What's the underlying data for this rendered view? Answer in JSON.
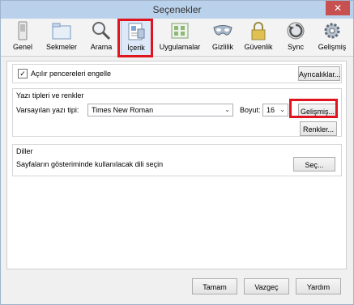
{
  "window": {
    "title": "Seçenekler",
    "close_glyph": "✕"
  },
  "toolbar": [
    {
      "label": "Genel",
      "icon": "switch-icon"
    },
    {
      "label": "Sekmeler",
      "icon": "tabs-icon"
    },
    {
      "label": "Arama",
      "icon": "magnifier-icon"
    },
    {
      "label": "İçerik",
      "icon": "document-icon",
      "active": true
    },
    {
      "label": "Uygulamalar",
      "icon": "apps-icon"
    },
    {
      "label": "Gizlilik",
      "icon": "mask-icon"
    },
    {
      "label": "Güvenlik",
      "icon": "lock-icon"
    },
    {
      "label": "Sync",
      "icon": "sync-icon"
    },
    {
      "label": "Gelişmiş",
      "icon": "gear-icon"
    }
  ],
  "popups": {
    "checkbox_label": "Açılır pencereleri engelle",
    "checked": true,
    "exceptions_button": "Ayrıcalıklar..."
  },
  "fonts": {
    "section_title": "Yazı tipleri ve renkler",
    "default_font_label": "Varsayılan yazı tipi:",
    "default_font_value": "Times New Roman",
    "size_label": "Boyut:",
    "size_value": "16",
    "advanced_button": "Gelişmiş...",
    "colors_button": "Renkler..."
  },
  "languages": {
    "section_title": "Diller",
    "description": "Sayfaların gösteriminde kullanılacak dili seçin",
    "choose_button": "Seç..."
  },
  "footer": {
    "ok": "Tamam",
    "cancel": "Vazgeç",
    "help": "Yardım"
  }
}
